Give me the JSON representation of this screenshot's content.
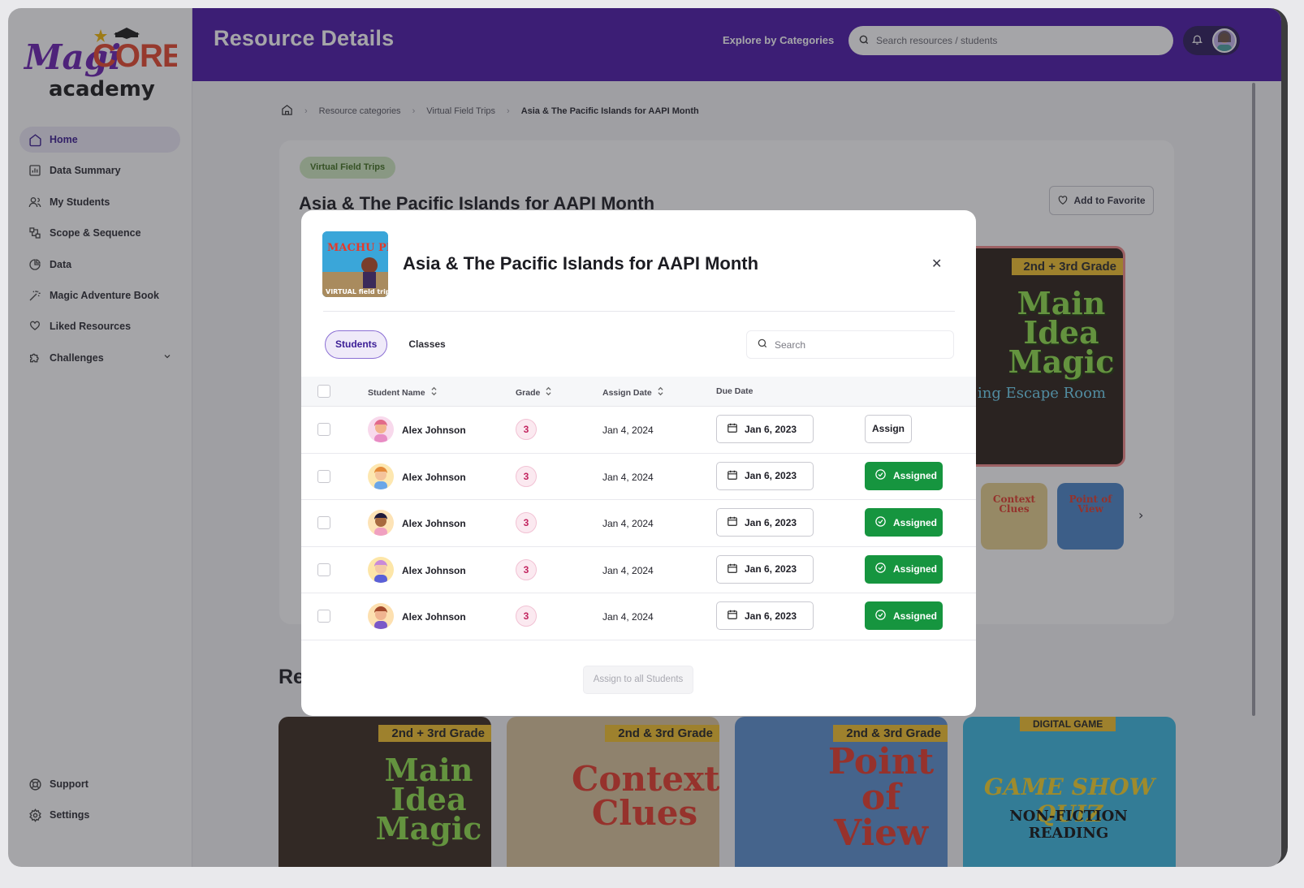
{
  "app": {
    "logo_text_1": "Magi",
    "logo_text_2": "CORE",
    "logo_text_3": "academy"
  },
  "sidebar": {
    "items": [
      {
        "label": "Home",
        "icon": "home-icon",
        "active": true
      },
      {
        "label": "Data Summary",
        "icon": "chart-icon"
      },
      {
        "label": "My Students",
        "icon": "users-icon"
      },
      {
        "label": "Scope & Sequence",
        "icon": "sequence-icon"
      },
      {
        "label": "Data",
        "icon": "pie-icon"
      },
      {
        "label": "Magic Adventure Book",
        "icon": "wand-icon"
      },
      {
        "label": "Liked Resources",
        "icon": "liked-icon"
      },
      {
        "label": "Challenges",
        "icon": "puzzle-icon"
      }
    ],
    "bottom": [
      {
        "label": "Support",
        "icon": "lifebuoy-icon"
      },
      {
        "label": "Settings",
        "icon": "gear-icon"
      }
    ]
  },
  "header": {
    "title": "Resource Details",
    "explore": "Explore by Categories",
    "search_placeholder": "Search resources / students"
  },
  "breadcrumb": {
    "items": [
      "Resource categories",
      "Virtual Field Trips",
      "Asia & The Pacific Islands for AAPI Month"
    ]
  },
  "resource": {
    "tag": "Virtual Field Trips",
    "title": "Asia & The Pacific Islands for AAPI Month",
    "favorite_label": "Add to Favorite",
    "hero_grade": "2nd + 3rd Grade",
    "hero_title": "Main Idea Magic",
    "hero_sub": "ing Escape Room",
    "thumbs": [
      "Context Clues",
      "Point of View"
    ]
  },
  "related": {
    "title_partial": "Re",
    "cards": [
      {
        "grade": "2nd + 3rd Grade",
        "title": "Main Idea Magic"
      },
      {
        "grade": "2nd & 3rd Grade",
        "title": "Context Clues"
      },
      {
        "grade": "2nd & 3rd Grade",
        "title": "Point of View"
      },
      {
        "grade": "DIGITAL GAME",
        "title": "GAME SHOW QUIZ",
        "sub": "NON-FICTION READING"
      }
    ]
  },
  "modal": {
    "title": "Asia & The Pacific Islands for AAPI Month",
    "thumb_text": "MACHU PICCHU",
    "thumb_sub": "VIRTUAL field trip",
    "tabs": [
      "Students",
      "Classes"
    ],
    "search_placeholder": "Search",
    "columns": {
      "name": "Student Name",
      "grade": "Grade",
      "assign_date": "Assign Date",
      "due_date": "Due Date"
    },
    "rows": [
      {
        "name": "Alex Johnson",
        "grade": "3",
        "assign_date": "Jan 4, 2024",
        "due_date": "Jan 6, 2023",
        "status": "Assign"
      },
      {
        "name": "Alex Johnson",
        "grade": "3",
        "assign_date": "Jan 4, 2024",
        "due_date": "Jan 6, 2023",
        "status": "Assigned"
      },
      {
        "name": "Alex Johnson",
        "grade": "3",
        "assign_date": "Jan 4, 2024",
        "due_date": "Jan 6, 2023",
        "status": "Assigned"
      },
      {
        "name": "Alex Johnson",
        "grade": "3",
        "assign_date": "Jan 4, 2024",
        "due_date": "Jan 6, 2023",
        "status": "Assigned"
      },
      {
        "name": "Alex Johnson",
        "grade": "3",
        "assign_date": "Jan 4, 2024",
        "due_date": "Jan 6, 2023",
        "status": "Assigned"
      }
    ],
    "assign_all": "Assign to all Students"
  },
  "colors": {
    "brand": "#4b18a8",
    "assigned": "#16953f",
    "grade_badge": "#c2245f"
  }
}
